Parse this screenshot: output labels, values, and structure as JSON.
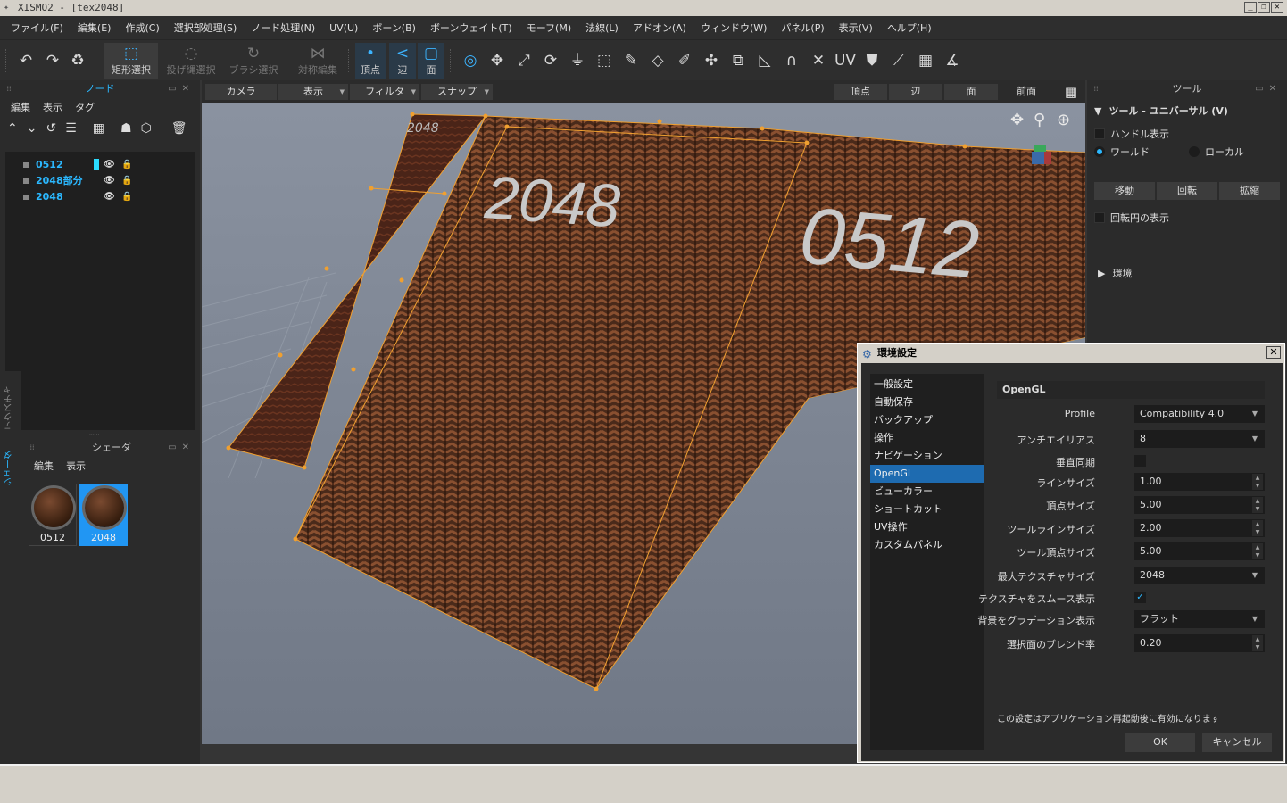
{
  "window": {
    "title": "XISMO2 - [tex2048]",
    "buttons": [
      "_",
      "❐",
      "✕"
    ]
  },
  "menu": [
    "ファイル(F)",
    "編集(E)",
    "作成(C)",
    "選択部処理(S)",
    "ノード処理(N)",
    "UV(U)",
    "ボーン(B)",
    "ボーンウェイト(T)",
    "モーフ(M)",
    "法線(L)",
    "アドオン(A)",
    "ウィンドウ(W)",
    "パネル(P)",
    "表示(V)",
    "ヘルプ(H)"
  ],
  "toolbar": {
    "rect_select": "矩形選択",
    "lasso_select": "投げ縄選択",
    "brush_select": "ブラシ選択",
    "symmetry_edit": "対称編集",
    "vertex": "頂点",
    "edge": "辺",
    "face": "面"
  },
  "node_panel": {
    "title": "ノード",
    "menu": [
      "編集",
      "表示",
      "タグ"
    ],
    "nodes": [
      {
        "name": "0512",
        "visible": true,
        "active": true
      },
      {
        "name": "2048部分",
        "visible": true
      },
      {
        "name": "2048",
        "visible": true
      }
    ]
  },
  "side_tabs": [
    "テクスチャ",
    "シェーダ"
  ],
  "shader_panel": {
    "title": "シェーダ",
    "menu": [
      "編集",
      "表示"
    ],
    "items": [
      {
        "name": "0512",
        "selected": false
      },
      {
        "name": "2048",
        "selected": true
      }
    ]
  },
  "viewport_bar": {
    "camera": "カメラ",
    "display": "表示",
    "filter": "フィルタ",
    "snap": "スナップ",
    "vertex": "頂点",
    "edge": "辺",
    "face": "面",
    "view": "前面"
  },
  "viewport": {
    "label_small": "2048",
    "label_large_left": "2048",
    "label_large_right": "0512"
  },
  "tool_panel": {
    "title": "ツール",
    "section": "ツール - ユニバーサル (V)",
    "handle_display": "ハンドル表示",
    "world": "ワールド",
    "local": "ローカル",
    "move": "移動",
    "rotate": "回転",
    "scale": "拡縮",
    "rotation_circle": "回転円の表示",
    "environment": "環境"
  },
  "dialog": {
    "title": "環境設定",
    "categories": [
      "一般設定",
      "自動保存",
      "バックアップ",
      "操作",
      "ナビゲーション",
      "OpenGL",
      "ビューカラー",
      "ショートカット",
      "UV操作",
      "カスタムパネル"
    ],
    "selected_category": "OpenGL",
    "section": "OpenGL",
    "fields": {
      "profile_label": "Profile",
      "profile": "Compatibility 4.0",
      "aa_label": "アンチエイリアス",
      "aa": "8",
      "vsync_label": "垂直同期",
      "line_size_label": "ラインサイズ",
      "line_size": "1.00",
      "vertex_size_label": "頂点サイズ",
      "vertex_size": "5.00",
      "tool_line_label": "ツールラインサイズ",
      "tool_line": "2.00",
      "tool_vertex_label": "ツール頂点サイズ",
      "tool_vertex": "5.00",
      "max_tex_label": "最大テクスチャサイズ",
      "max_tex": "2048",
      "smooth_label": "テクスチャをスムース表示",
      "bg_grad_label": "背景をグラデーション表示",
      "bg_grad": "フラット",
      "blend_label": "選択面のブレンド率",
      "blend": "0.20"
    },
    "note": "この設定はアプリケーション再起動後に有効になります",
    "ok": "OK",
    "cancel": "キャンセル"
  },
  "colors": {
    "accent": "#2bb8ff",
    "selection": "#2196f3",
    "edge": "#f0a030"
  }
}
